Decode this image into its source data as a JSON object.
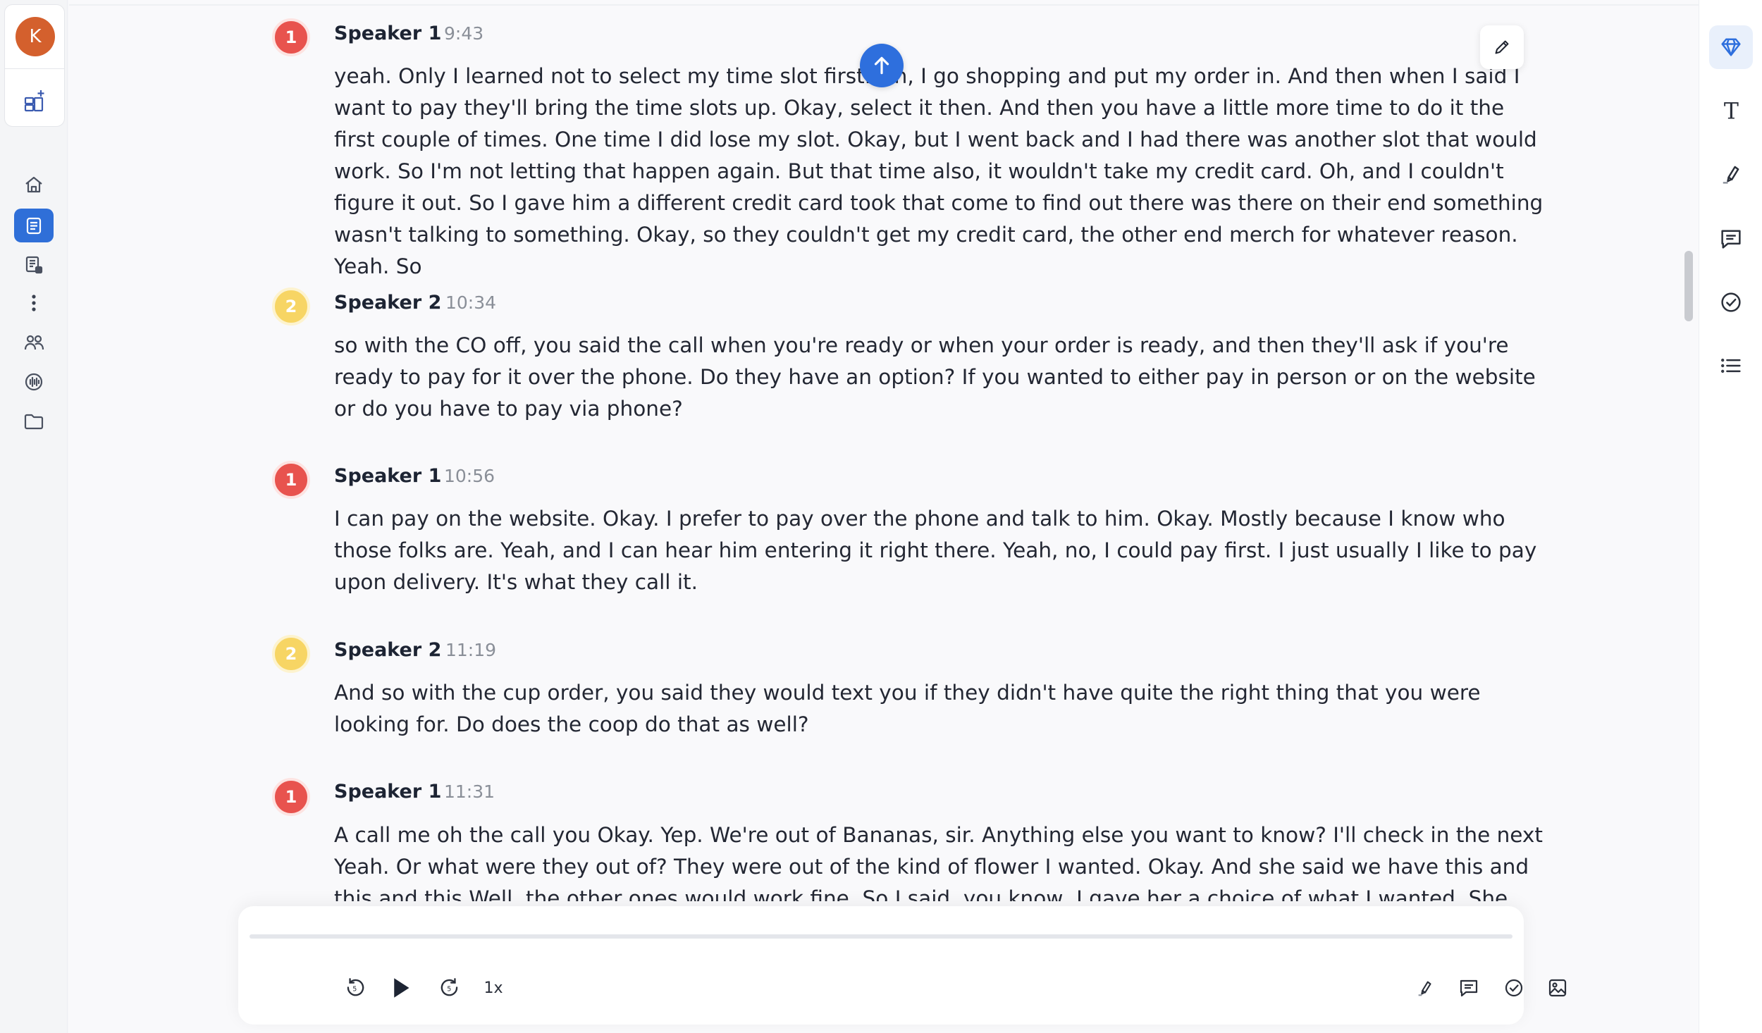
{
  "account": {
    "avatar_initial": "K"
  },
  "nav": {
    "items": [
      {
        "icon": "home-icon"
      },
      {
        "icon": "transcript-icon",
        "active": true
      },
      {
        "icon": "notes-list-icon"
      },
      {
        "icon": "more-vertical-icon"
      },
      {
        "icon": "people-icon"
      },
      {
        "icon": "audio-icon"
      },
      {
        "icon": "folder-icon"
      }
    ]
  },
  "transcript": {
    "segments": [
      {
        "speaker": "Speaker 1",
        "badge": "1",
        "time": "9:43",
        "text": "yeah. Only I learned not to select my time slot first. Oh, I go shopping and put my order in. And then when I said I want to pay they'll bring the time slots up. Okay, select it then. And then you have a little more time to do it the first couple of times. One time I did lose my slot. Okay, but I went back and I had there was another slot that would work. So I'm not letting that happen again. But that time also, it wouldn't take my credit card. Oh, and I couldn't figure it out. So I gave him a different credit card took that come to find out there was there on their end something wasn't talking to something. Okay, so they couldn't get my credit card, the other end merch for whatever reason. Yeah. So"
      },
      {
        "speaker": "Speaker 2",
        "badge": "2",
        "time": "10:34",
        "text": "so with the CO off, you said the call when you're ready or when your order is ready, and then they'll ask if you're ready to pay for it over the phone. Do they have an option? If you wanted to either pay in person or on the website or do you have to pay via phone?"
      },
      {
        "speaker": "Speaker 1",
        "badge": "1",
        "time": "10:56",
        "text": "I can pay on the website. Okay. I prefer to pay over the phone and talk to him. Okay. Mostly because I know who those folks are. Yeah, and I can hear him entering it right there. Yeah, no, I could pay first. I just usually I like to pay upon delivery. It's what they call it."
      },
      {
        "speaker": "Speaker 2",
        "badge": "2",
        "time": "11:19",
        "text": "And so with the cup order, you said they would text you if they didn't have quite the right thing that you were looking for. Do does the coop do that as well?"
      },
      {
        "speaker": "Speaker 1",
        "badge": "1",
        "time": "11:31",
        "text": "A call me oh the call you Okay. Yep. We're out of Bananas, sir. Anything else you want to know? I'll check in the next Yeah. Or what were they out of? They were out of the kind of flower I wanted. Okay. And she said we have this and this and this Well, the other ones would work fine. So I said, you know, I gave her a choice of what I wanted. She said"
      }
    ]
  },
  "player": {
    "progress": 0.0,
    "speed": "1x",
    "controls": [
      "rewind-5-icon",
      "play-icon",
      "forward-5-icon",
      "highlight-icon",
      "comment-icon",
      "check-circle-icon",
      "image-icon"
    ]
  },
  "tools": [
    "diamond-icon",
    "text-icon",
    "highlighter-icon",
    "comment-icon",
    "check-circle-icon",
    "list-icon"
  ]
}
